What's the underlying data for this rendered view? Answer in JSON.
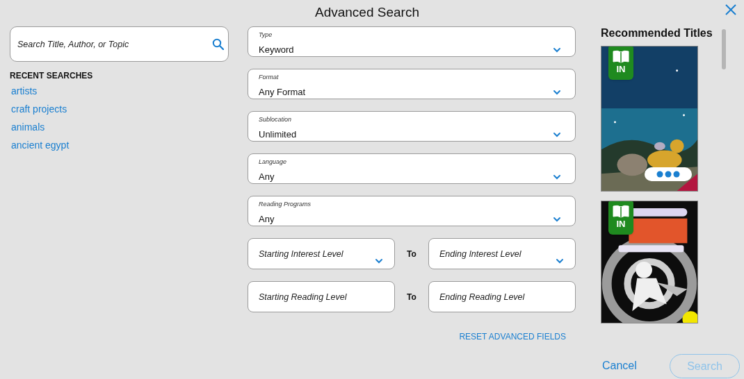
{
  "title": "Advanced Search",
  "search": {
    "placeholder": "Search Title, Author, or Topic"
  },
  "recent": {
    "heading": "RECENT SEARCHES",
    "items": [
      "artists",
      "craft projects",
      "animals",
      "ancient egypt"
    ]
  },
  "selects": [
    {
      "label": "Type",
      "value": "Keyword"
    },
    {
      "label": "Format",
      "value": "Any Format"
    },
    {
      "label": "Sublocation",
      "value": "Unlimited"
    },
    {
      "label": "Language",
      "value": "Any"
    },
    {
      "label": "Reading Programs",
      "value": "Any"
    }
  ],
  "ranges": [
    {
      "from_placeholder": "Starting Interest Level",
      "joiner": "To",
      "to_placeholder": "Ending Interest Level",
      "dropdown": true
    },
    {
      "from_placeholder": "Starting Reading Level",
      "joiner": "To",
      "to_placeholder": "Ending Reading Level",
      "dropdown": false
    }
  ],
  "reset": "RESET ADVANCED FIELDS",
  "recommended": {
    "heading": "Recommended Titles",
    "books": [
      {
        "kind": "picture",
        "badge": "IN",
        "menu": true
      },
      {
        "kind": "picture",
        "badge": "IN",
        "menu": false
      }
    ]
  },
  "buttons": {
    "cancel": "Cancel",
    "search": {
      "label": "Search",
      "disabled": true
    }
  }
}
